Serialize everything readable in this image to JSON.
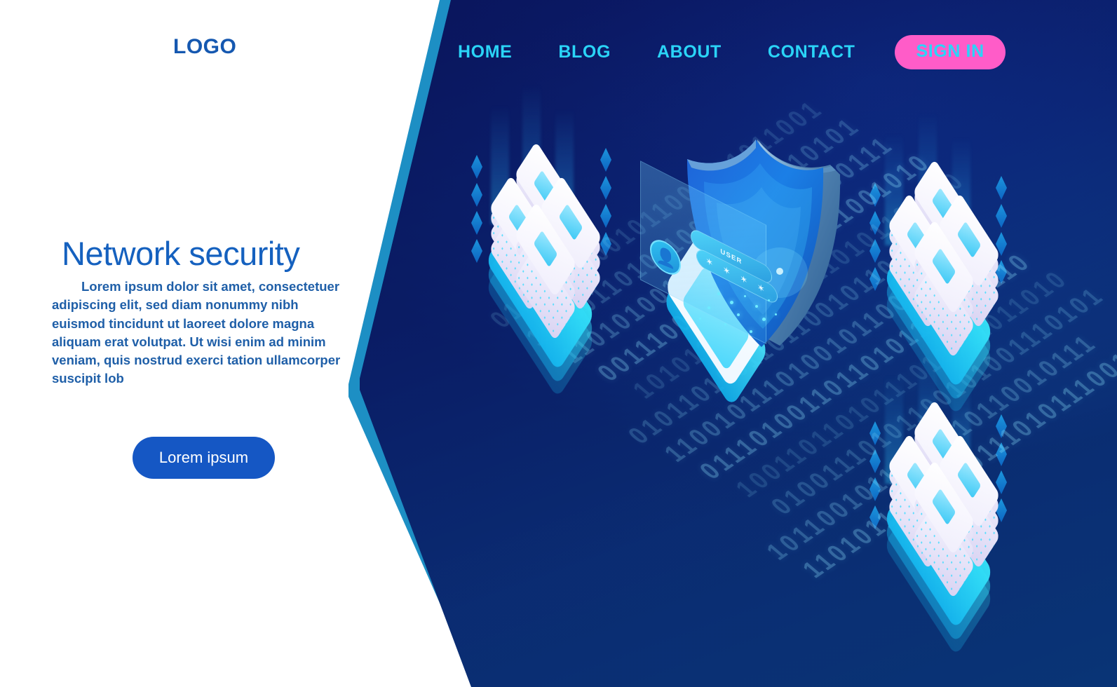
{
  "brand": {
    "logo": "LOGO"
  },
  "nav": {
    "items": [
      {
        "label": "HOME"
      },
      {
        "label": "BLOG"
      },
      {
        "label": "ABOUT"
      },
      {
        "label": "CONTACT"
      }
    ],
    "signin_label": "SIGN IN"
  },
  "hero": {
    "headline": "Network security",
    "body": "Lorem ipsum dolor sit amet, consectetuer adipiscing elit, sed diam nonummy nibh euismod tincidunt ut laoreet dolore magna aliquam erat volutpat. Ut wisi enim ad minim veniam, quis nostrud exerci tation ullamcorper suscipit lob",
    "cta_label": "Lorem ipsum"
  },
  "illustration": {
    "login_panel": {
      "user_field_label": "USER",
      "password_field_value": "✶ ✶ ✶ ✶",
      "avatar_icon": "user-avatar-icon"
    },
    "shield_icon": "security-shield-icon",
    "server_racks": [
      {
        "name": "server-rack-left"
      },
      {
        "name": "server-rack-right-top"
      },
      {
        "name": "server-rack-right-bottom"
      }
    ],
    "background_code_rows": [
      "011010110010110",
      "101001101011001",
      "110101001110100",
      "001110010101101",
      "101011011001011",
      "010110100110110",
      "110010111010010",
      "011101001101101",
      "100110110101110",
      "010011101011001",
      "101100101110011",
      "110101110010101",
      "001011010110100",
      "111001011101010"
    ]
  },
  "colors": {
    "brand_blue": "#1558b0",
    "nav_cyan": "#2ad4f7",
    "signin_pink": "#ff5cc8",
    "heading_blue": "#1561bf",
    "cta_blue": "#1557c4",
    "panel_dark": "#0b1461",
    "panel_edge": "#1d8fc4"
  }
}
